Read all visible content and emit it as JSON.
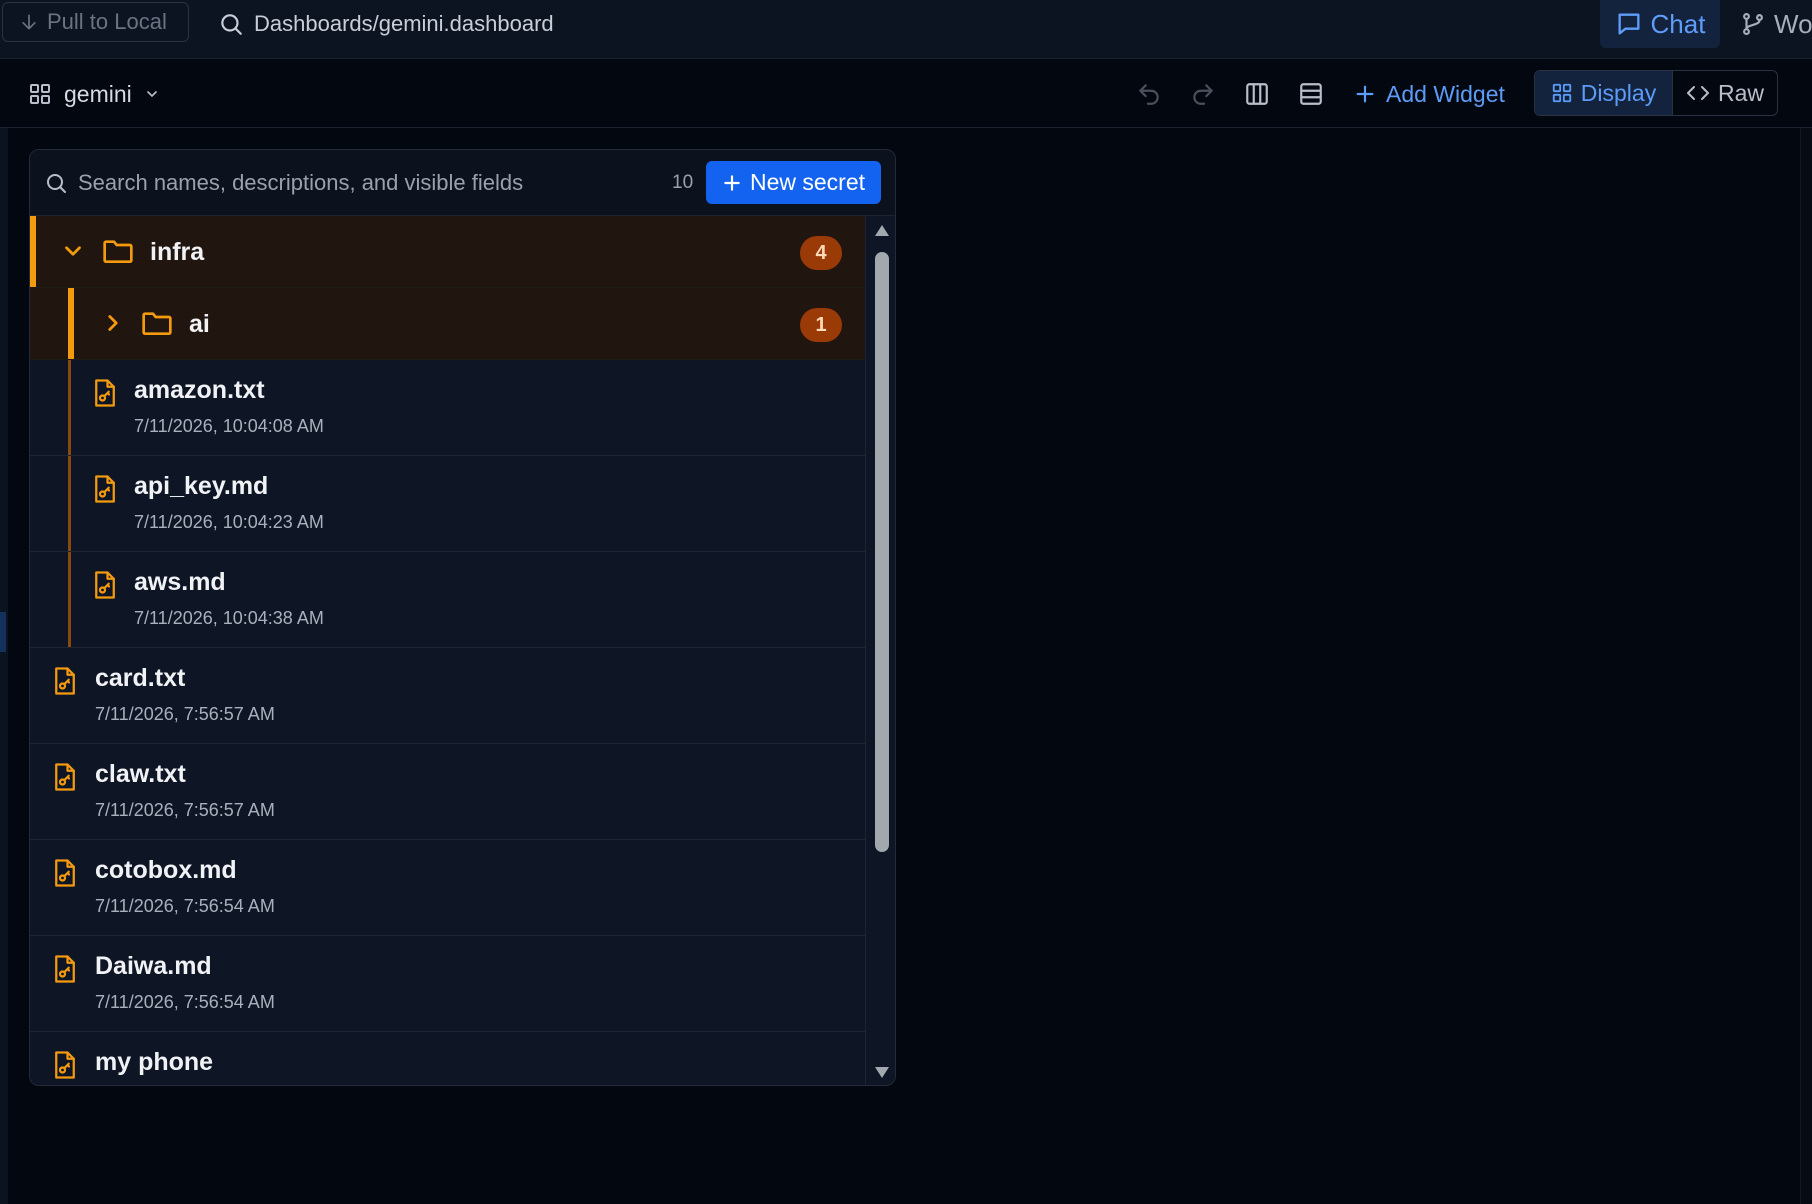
{
  "topbar": {
    "pull_label": "Pull to Local",
    "path": "Dashboards/gemini.dashboard",
    "chat_label": "Chat",
    "wo_label": "Wo"
  },
  "toolbar": {
    "dashboard_name": "gemini",
    "add_widget_label": "Add Widget",
    "display_label": "Display",
    "raw_label": "Raw"
  },
  "panel": {
    "search_placeholder": "Search names, descriptions, and visible fields",
    "count": "10",
    "new_secret_label": "New secret",
    "folders": [
      {
        "name": "infra",
        "count": "4",
        "expanded": true
      },
      {
        "name": "ai",
        "count": "1",
        "expanded": false
      }
    ],
    "files": [
      {
        "name": "amazon.txt",
        "date": "7/11/2026, 10:04:08 AM"
      },
      {
        "name": "api_key.md",
        "date": "7/11/2026, 10:04:23 AM"
      },
      {
        "name": "aws.md",
        "date": "7/11/2026, 10:04:38 AM"
      },
      {
        "name": "card.txt",
        "date": "7/11/2026, 7:56:57 AM"
      },
      {
        "name": "claw.txt",
        "date": "7/11/2026, 7:56:57 AM"
      },
      {
        "name": "cotobox.md",
        "date": "7/11/2026, 7:56:54 AM"
      },
      {
        "name": "Daiwa.md",
        "date": "7/11/2026, 7:56:54 AM"
      },
      {
        "name": "my phone",
        "date": ""
      }
    ]
  },
  "colors": {
    "accent": "#1463f0",
    "folder_accent": "#f39a0f",
    "badge": "#9a3a07",
    "link": "#5c9cf8"
  }
}
